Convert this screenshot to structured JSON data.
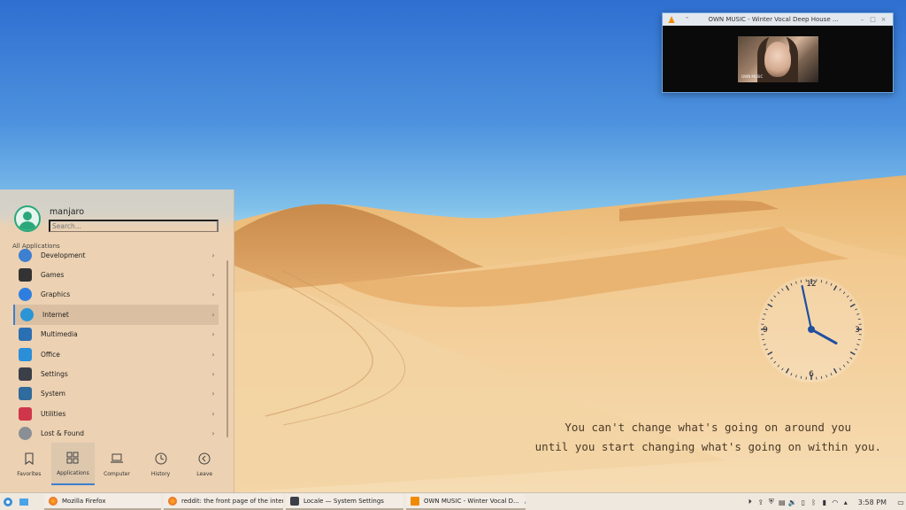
{
  "vlc": {
    "title": "OWN MUSIC - Winter Vocal Deep House ...",
    "video_caption": "OWN MUSIC"
  },
  "quote": {
    "line1": "You can't change what's going on around you",
    "line2": "until you start changing what's going on within you."
  },
  "clock": {
    "n12": "12",
    "n3": "3",
    "n6": "6",
    "n9": "9",
    "hours": 3,
    "minutes": 58
  },
  "launcher": {
    "username": "manjaro",
    "search_placeholder": "Search...",
    "section_label": "All Applications",
    "items": [
      {
        "label": "Development",
        "icon": "development-icon",
        "color": "#3d7fd1"
      },
      {
        "label": "Games",
        "icon": "gamepad-icon",
        "color": "#333333"
      },
      {
        "label": "Graphics",
        "icon": "graphics-icon",
        "color": "#2d7ee0"
      },
      {
        "label": "Internet",
        "icon": "globe-icon",
        "color": "#2b95d6"
      },
      {
        "label": "Multimedia",
        "icon": "multimedia-icon",
        "color": "#2b6fb3"
      },
      {
        "label": "Office",
        "icon": "office-icon",
        "color": "#2a8fd8"
      },
      {
        "label": "Settings",
        "icon": "settings-icon",
        "color": "#3a3f48"
      },
      {
        "label": "System",
        "icon": "system-icon",
        "color": "#2f6b9c"
      },
      {
        "label": "Utilities",
        "icon": "utilities-icon",
        "color": "#d0364a"
      },
      {
        "label": "Lost & Found",
        "icon": "lost-found-icon",
        "color": "#8a8f96"
      }
    ],
    "tabs": [
      {
        "label": "Favorites"
      },
      {
        "label": "Applications"
      },
      {
        "label": "Computer"
      },
      {
        "label": "History"
      },
      {
        "label": "Leave"
      }
    ]
  },
  "taskbar": {
    "tasks": [
      {
        "label": "Mozilla Firefox"
      },
      {
        "label": "reddit: the front page of the inter..."
      },
      {
        "label": "Locale  — System Settings"
      },
      {
        "label": "OWN MUSIC - Winter Vocal D..."
      }
    ],
    "time": "3:58 PM"
  }
}
